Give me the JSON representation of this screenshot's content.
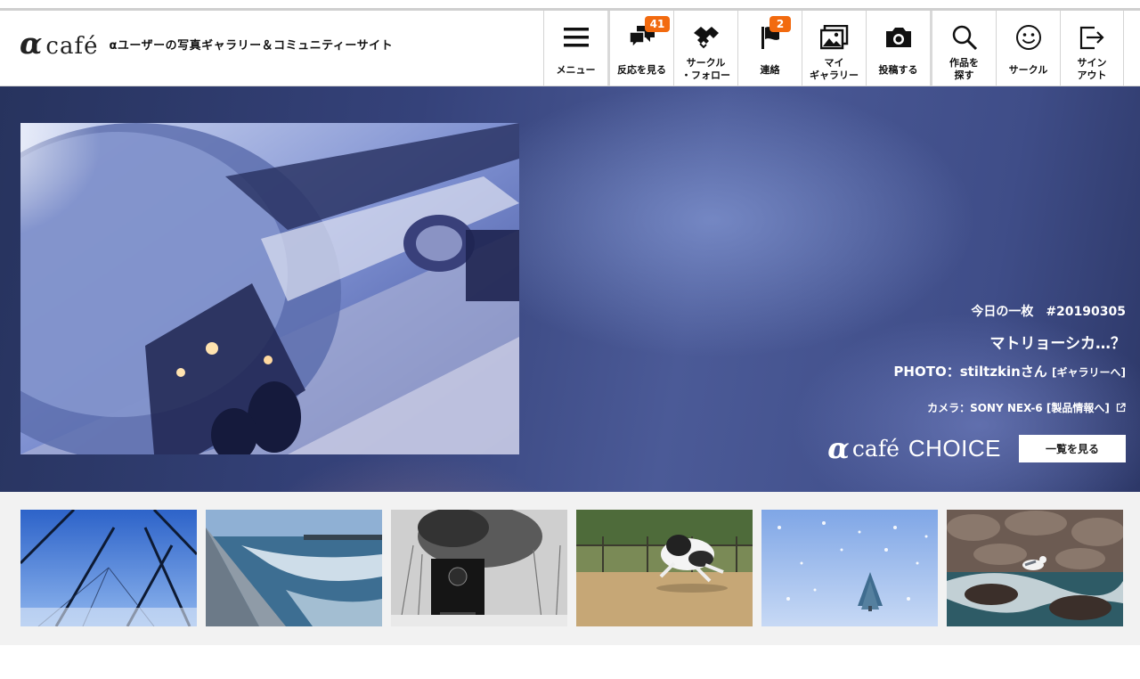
{
  "header": {
    "logo_alpha": "α",
    "logo_cafe": "café",
    "tagline": "αユーザーの写真ギャラリー＆コミュニティーサイト"
  },
  "nav": [
    {
      "label": "メニュー",
      "icon": "hamburger-menu-icon"
    },
    {
      "label": "反応を見る",
      "icon": "speech-bubbles-icon",
      "badge": "41"
    },
    {
      "label": "サークル\n・フォロー",
      "icon": "handshake-icon"
    },
    {
      "label": "連絡",
      "icon": "flag-icon",
      "badge": "2"
    },
    {
      "label": "マイ\nギャラリー",
      "icon": "gallery-icon"
    },
    {
      "label": "投稿する",
      "icon": "camera-icon"
    },
    {
      "label": "作品を\n探す",
      "icon": "search-icon"
    },
    {
      "label": "サークル",
      "icon": "smiley-icon"
    },
    {
      "label": "サイン\nアウト",
      "icon": "sign-out-icon"
    }
  ],
  "hero": {
    "date": "今日の一枚　#20190305",
    "title": "マトリョーシカ…？",
    "photo_by": "PHOTO：stiltzkinさん ",
    "gallery_link": "[ギャラリーへ]",
    "camera": "カメラ：SONY NEX-6 [製品情報へ]",
    "choice_alpha": "α",
    "choice_cafe": "café",
    "choice_word": "CHOICE",
    "list_button": "一覧を見る"
  },
  "thumbnails": [
    {
      "subject": "winter-trees"
    },
    {
      "subject": "seawall-waves"
    },
    {
      "subject": "steam-locomotive"
    },
    {
      "subject": "running-dog"
    },
    {
      "subject": "snowy-tree"
    },
    {
      "subject": "seagull-rocks"
    }
  ],
  "colors": {
    "badge": "#f26a0f",
    "hero_bg": "#3f4d88",
    "strip_bg": "#f2f2f2"
  }
}
